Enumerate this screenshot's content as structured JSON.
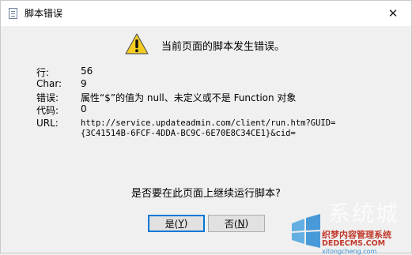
{
  "window": {
    "title": "脚本错误",
    "close_glyph": "✕"
  },
  "dialog": {
    "headline": "当前页面的脚本发生错误。",
    "fields": {
      "line_label": "行:",
      "line_value": "56",
      "char_label": "Char:",
      "char_value": "9",
      "error_label": "错误:",
      "error_value": "属性“$”的值为 null、未定义或不是 Function 对象",
      "code_label": "代码:",
      "code_value": "0",
      "url_label": "URL:",
      "url_value_line1": "http://service.updateadmin.com/client/run.htm?GUID=",
      "url_value_line2": "{3C41514B-6FCF-4DDA-BC9C-6E70E8C34CE1}&cid="
    },
    "question": "是否要在此页面上继续运行脚本?",
    "buttons": {
      "yes_label": "是(",
      "yes_mnemonic": "Y",
      "yes_close": ")",
      "no_label": "否(",
      "no_mnemonic": "N",
      "no_close": ")"
    }
  },
  "watermark": {
    "line1": "系统城",
    "line2": "织梦内容管理系统",
    "line3": "DEDECMS.COM",
    "line4": "xitongcheng.com"
  },
  "colors": {
    "dialog_bg": "#f0f0f0",
    "titlebar_bg": "#ffffff",
    "warning_yellow": "#f5cd1f",
    "default_button_border": "#0078d7"
  }
}
